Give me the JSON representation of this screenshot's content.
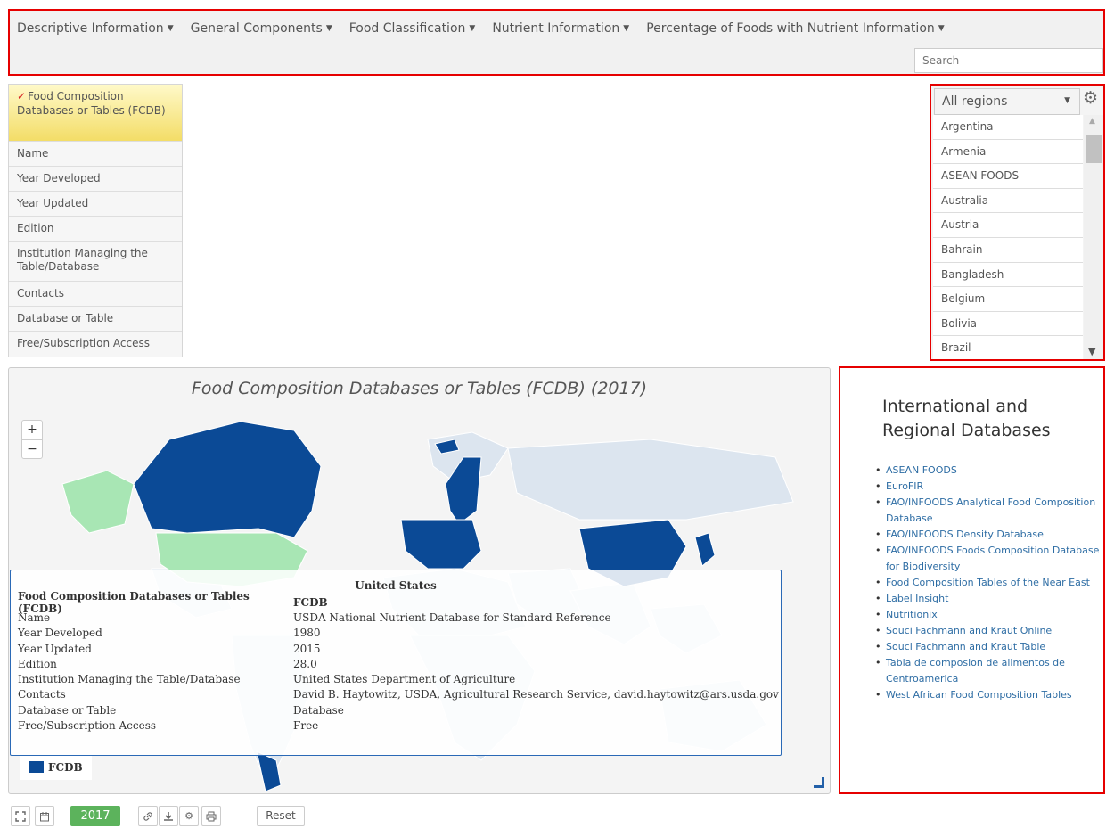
{
  "nav": {
    "menus": [
      {
        "label": "Descriptive Information"
      },
      {
        "label": "General Components"
      },
      {
        "label": "Food Classification"
      },
      {
        "label": "Nutrient Information"
      },
      {
        "label": "Percentage of Foods with Nutrient Information"
      }
    ],
    "search_placeholder": "Search"
  },
  "left_menu": {
    "active_label": "Food Composition Databases or Tables (FCDB)",
    "items": [
      {
        "label": "Name"
      },
      {
        "label": "Year Developed"
      },
      {
        "label": "Year Updated"
      },
      {
        "label": "Edition"
      },
      {
        "label": "Institution Managing the Table/Database"
      },
      {
        "label": "Contacts"
      },
      {
        "label": "Database or Table"
      },
      {
        "label": "Free/Subscription Access"
      }
    ]
  },
  "regions": {
    "selected": "All regions",
    "items": [
      "Argentina",
      "Armenia",
      "ASEAN FOODS",
      "Australia",
      "Austria",
      "Bahrain",
      "Bangladesh",
      "Belgium",
      "Bolivia",
      "Brazil"
    ]
  },
  "map": {
    "title": "Food Composition Databases or Tables (FCDB) (2017)",
    "zoom_in_label": "+",
    "zoom_out_label": "−",
    "legend_label": "FCDB",
    "colors": {
      "fcdb": "#0b4a96",
      "highlight": "#a8e6b4",
      "other": "#dce5ef"
    }
  },
  "tooltip": {
    "country": "United States",
    "rows": [
      {
        "key": "Food Composition Databases or Tables (FCDB)",
        "value": "FCDB"
      },
      {
        "key": "Name",
        "value": "USDA National Nutrient Database for Standard Reference"
      },
      {
        "key": "Year Developed",
        "value": "1980"
      },
      {
        "key": "Year Updated",
        "value": "2015"
      },
      {
        "key": "Edition",
        "value": "28.0"
      },
      {
        "key": "Institution Managing the Table/Database",
        "value": "United States Department of Agriculture"
      },
      {
        "key": "Contacts",
        "value": "David B. Haytowitz, USDA, Agricultural Research Service, david.haytowitz@ars.usda.gov"
      },
      {
        "key": "Database or Table",
        "value": "Database"
      },
      {
        "key": "Free/Subscription Access",
        "value": "Free"
      }
    ]
  },
  "databases": {
    "heading": "International and Regional Databases",
    "links": [
      "ASEAN FOODS",
      "EuroFIR",
      "FAO/INFOODS Analytical Food Composition Database",
      "FAO/INFOODS Density Database",
      "FAO/INFOODS Foods Composition Database for Biodiversity",
      "Food Composition Tables of the Near East",
      "Label Insight",
      "Nutritionix",
      "Souci Fachmann and Kraut Online",
      "Souci Fachmann and Kraut Table",
      "Tabla de composion de alimentos de Centroamerica",
      "West African Food Composition Tables"
    ]
  },
  "toolbar": {
    "year_label": "2017",
    "reset_label": "Reset"
  }
}
